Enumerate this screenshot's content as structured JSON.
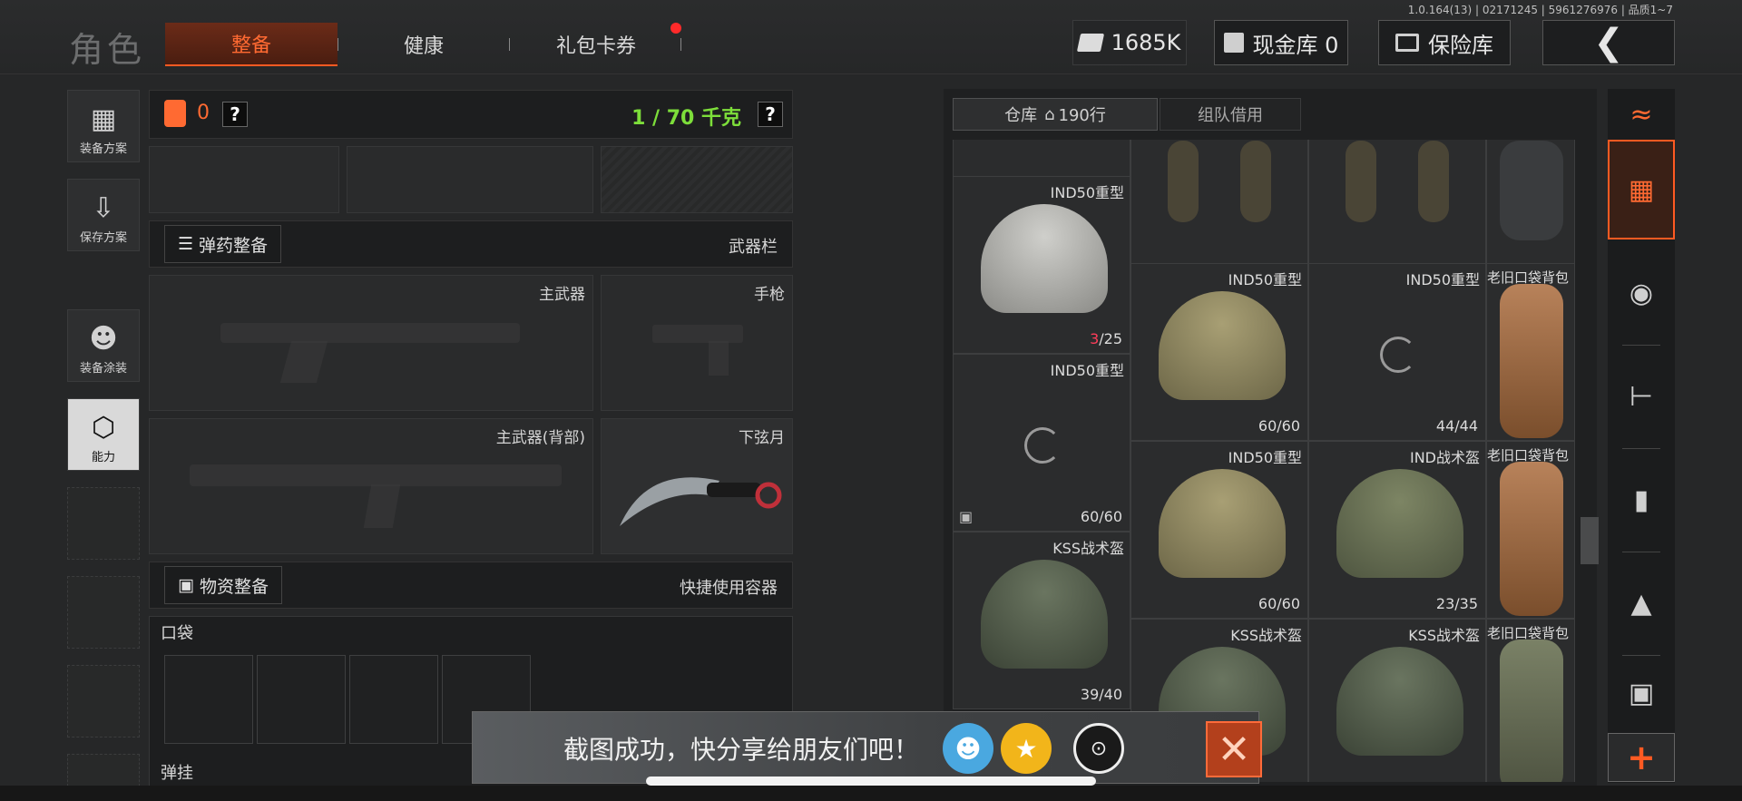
{
  "header": {
    "version": "1.0.164(13) | 02171245 | 5961276976 | 品质1~7",
    "title": "角色",
    "tabs": [
      "整备",
      "健康",
      "礼包卡券"
    ],
    "currency": "1685K",
    "cash_vault": "现金库 0",
    "insurance": "保险库",
    "back_icon": "chevron-left-icon"
  },
  "sidebar": {
    "items": [
      {
        "label": "装备方案",
        "icon": "vest-icon"
      },
      {
        "label": "保存方案",
        "icon": "download-icon"
      },
      {
        "label": "装备涂装",
        "icon": "soldier-icon"
      },
      {
        "label": "能力",
        "icon": "lightning-icon"
      }
    ]
  },
  "loadout": {
    "armor_value": "0",
    "weight": "1 / 70 千克",
    "ammo_button": "弹药整备",
    "weapons_title": "武器栏",
    "primary": "主武器",
    "pistol": "手枪",
    "primary_back": "主武器(背部)",
    "melee_name": "下弦月",
    "supply_button": "物资整备",
    "quick_container": "快捷使用容器",
    "pockets": "口袋",
    "rig": "弹挂",
    "question": "?"
  },
  "warehouse": {
    "tabs": [
      "仓库",
      "组队借用"
    ],
    "rows": "190行",
    "items": [
      {
        "name": "IND50重型",
        "durability_current": "3",
        "durability_total": "/25"
      },
      {
        "name": "IND50重型",
        "durability": "60/60"
      },
      {
        "name": "IND50重型",
        "durability": "44/44"
      },
      {
        "name": "老旧口袋背包"
      },
      {
        "name": "IND50重型",
        "durability": "60/60"
      },
      {
        "name": "IND50重型",
        "durability": "60/60"
      },
      {
        "name": "IND战术盔",
        "durability": "23/35"
      },
      {
        "name": "老旧口袋背包"
      },
      {
        "name": "KSS战术盔",
        "durability": "39/40"
      },
      {
        "name": "KSS战术盔"
      },
      {
        "name": "KSS战术盔"
      },
      {
        "name": "老旧口袋背包"
      }
    ]
  },
  "toast": {
    "message": "截图成功，快分享给朋友们吧！"
  },
  "colors": {
    "accent": "#ff5a22",
    "weight_green": "#7dde3a",
    "durability_red": "#ff3d5a"
  }
}
